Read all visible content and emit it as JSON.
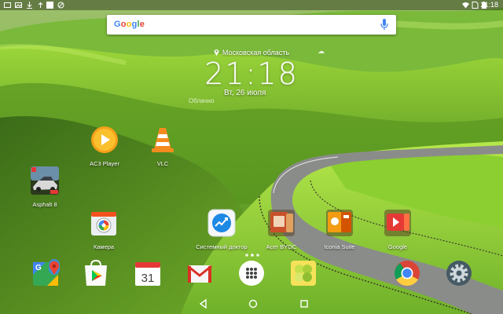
{
  "status_bar": {
    "time": "21:18",
    "icons": [
      "gallery-icon",
      "image-icon",
      "download-icon",
      "upload-icon",
      "sync-icon",
      "notification-icon",
      "wifi-icon",
      "no-sim-icon",
      "battery-icon"
    ]
  },
  "search": {
    "logo_text": "Google",
    "logo_colors": [
      "#4285f4",
      "#ea4335",
      "#fbbc05",
      "#4285f4",
      "#34a853",
      "#ea4335"
    ],
    "mic_color": "#4285f4"
  },
  "clock_widget": {
    "location": "Московская область",
    "time": "21:18",
    "date": "Вт, 26 июля",
    "weather": "Облачно"
  },
  "apps": [
    {
      "label": "AC3 Player",
      "icon": "ac3-player-icon"
    },
    {
      "label": "VLC",
      "icon": "vlc-icon"
    },
    {
      "label": "Asphalt 8",
      "icon": "asphalt-8-icon"
    },
    {
      "label": "Камера",
      "icon": "camera-icon"
    },
    {
      "label": "Системный доктор",
      "icon": "system-doctor-icon"
    },
    {
      "label": "Acer BYOC",
      "icon": "acer-byoc-folder-icon"
    },
    {
      "label": "Iconia Suite",
      "icon": "iconia-suite-folder-icon"
    },
    {
      "label": "Google",
      "icon": "google-folder-icon"
    }
  ],
  "dock": [
    "maps-icon",
    "play-store-icon",
    "calendar-icon",
    "gmail-icon",
    "app-drawer-icon",
    "gallery-app-icon",
    "chrome-icon",
    "settings-icon"
  ],
  "calendar_day": "31",
  "navigation": [
    "back-icon",
    "home-icon",
    "recents-icon"
  ],
  "colors": {
    "sky": "#a8c8e0",
    "grass": "#6fb12a",
    "accent_orange": "#f7a01b",
    "gmail_red": "#d93025"
  }
}
